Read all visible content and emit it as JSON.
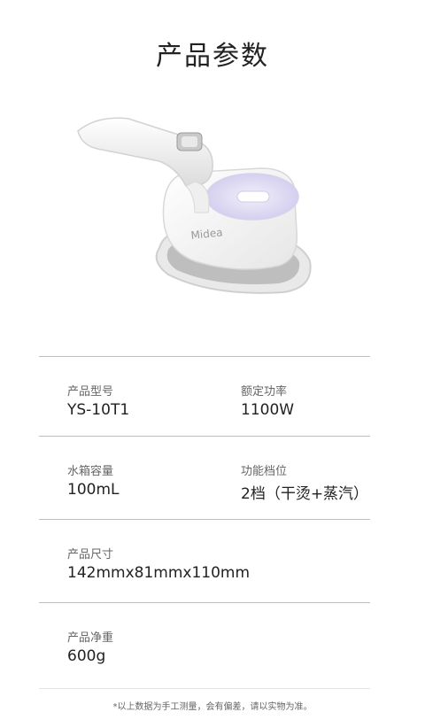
{
  "page": {
    "title": "产品参数",
    "product_image": {
      "icon": "handheld-steamer-illustration",
      "brand": "Midea"
    }
  },
  "specs": {
    "model": {
      "label": "产品型号",
      "value": "YS-10T1"
    },
    "power": {
      "label": "额定功率",
      "value": "1100W"
    },
    "tank": {
      "label": "水箱容量",
      "value": "100mL"
    },
    "modes": {
      "label": "功能档位",
      "value": "2档（干烫+蒸汽）"
    },
    "size": {
      "label": "产品尺寸",
      "value": "142mmx81mmx110mm"
    },
    "weight": {
      "label": "产品净重",
      "value": "600g"
    }
  },
  "footnote": "*以上数据为手工测量，会有偏差，请以实物为准。",
  "colors": {
    "background": "#ffffff",
    "divider": "#bdbdbd",
    "text": "#222222",
    "label": "#666666",
    "accent_lavender": "#d9d5f0"
  }
}
